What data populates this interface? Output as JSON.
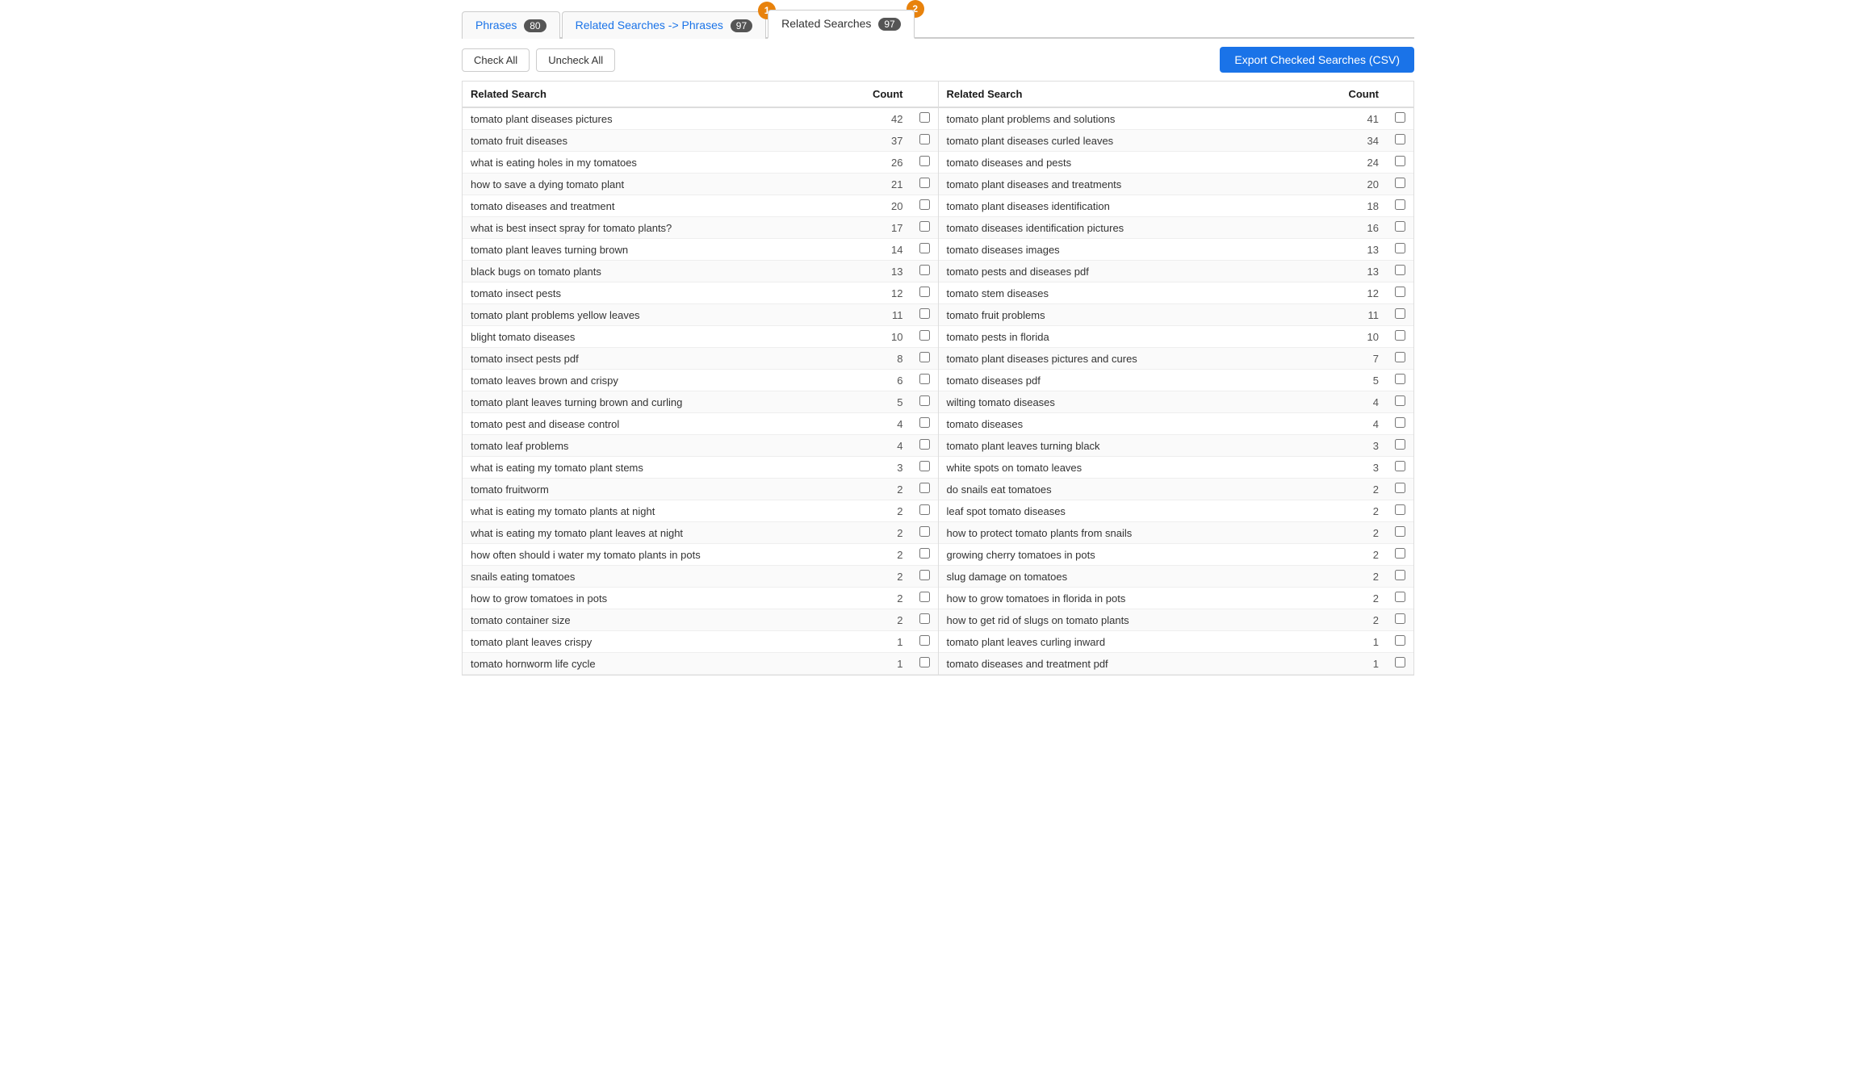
{
  "tabs": [
    {
      "id": "phrases",
      "label": "Phrases",
      "badge": "80",
      "active": false,
      "step": null
    },
    {
      "id": "related-to-phrases",
      "label": "Related Searches -> Phrases",
      "badge": "97",
      "active": false,
      "step": "1"
    },
    {
      "id": "related-searches",
      "label": "Related Searches",
      "badge": "97",
      "active": true,
      "step": "2"
    }
  ],
  "toolbar": {
    "check_all": "Check All",
    "uncheck_all": "Uncheck All",
    "export_button": "Export Checked Searches (CSV)"
  },
  "left_table": {
    "headers": [
      {
        "id": "related-search",
        "label": "Related Search"
      },
      {
        "id": "count",
        "label": "Count"
      },
      {
        "id": "check",
        "label": ""
      }
    ],
    "rows": [
      {
        "search": "tomato plant diseases pictures",
        "count": 42
      },
      {
        "search": "tomato fruit diseases",
        "count": 37
      },
      {
        "search": "what is eating holes in my tomatoes",
        "count": 26
      },
      {
        "search": "how to save a dying tomato plant",
        "count": 21
      },
      {
        "search": "tomato diseases and treatment",
        "count": 20
      },
      {
        "search": "what is best insect spray for tomato plants?",
        "count": 17
      },
      {
        "search": "tomato plant leaves turning brown",
        "count": 14
      },
      {
        "search": "black bugs on tomato plants",
        "count": 13
      },
      {
        "search": "tomato insect pests",
        "count": 12
      },
      {
        "search": "tomato plant problems yellow leaves",
        "count": 11
      },
      {
        "search": "blight tomato diseases",
        "count": 10
      },
      {
        "search": "tomato insect pests pdf",
        "count": 8
      },
      {
        "search": "tomato leaves brown and crispy",
        "count": 6
      },
      {
        "search": "tomato plant leaves turning brown and curling",
        "count": 5
      },
      {
        "search": "tomato pest and disease control",
        "count": 4
      },
      {
        "search": "tomato leaf problems",
        "count": 4
      },
      {
        "search": "what is eating my tomato plant stems",
        "count": 3
      },
      {
        "search": "tomato fruitworm",
        "count": 2
      },
      {
        "search": "what is eating my tomato plants at night",
        "count": 2
      },
      {
        "search": "what is eating my tomato plant leaves at night",
        "count": 2
      },
      {
        "search": "how often should i water my tomato plants in pots",
        "count": 2
      },
      {
        "search": "snails eating tomatoes",
        "count": 2
      },
      {
        "search": "how to grow tomatoes in pots",
        "count": 2
      },
      {
        "search": "tomato container size",
        "count": 2
      },
      {
        "search": "tomato plant leaves crispy",
        "count": 1
      },
      {
        "search": "tomato hornworm life cycle",
        "count": 1
      }
    ]
  },
  "right_table": {
    "headers": [
      {
        "id": "related-search-r",
        "label": "Related Search"
      },
      {
        "id": "count-r",
        "label": "Count"
      },
      {
        "id": "check-r",
        "label": ""
      }
    ],
    "rows": [
      {
        "search": "tomato plant problems and solutions",
        "count": 41
      },
      {
        "search": "tomato plant diseases curled leaves",
        "count": 34
      },
      {
        "search": "tomato diseases and pests",
        "count": 24
      },
      {
        "search": "tomato plant diseases and treatments",
        "count": 20
      },
      {
        "search": "tomato plant diseases identification",
        "count": 18
      },
      {
        "search": "tomato diseases identification pictures",
        "count": 16
      },
      {
        "search": "tomato diseases images",
        "count": 13
      },
      {
        "search": "tomato pests and diseases pdf",
        "count": 13
      },
      {
        "search": "tomato stem diseases",
        "count": 12
      },
      {
        "search": "tomato fruit problems",
        "count": 11
      },
      {
        "search": "tomato pests in florida",
        "count": 10
      },
      {
        "search": "tomato plant diseases pictures and cures",
        "count": 7
      },
      {
        "search": "tomato diseases pdf",
        "count": 5
      },
      {
        "search": "wilting tomato diseases",
        "count": 4
      },
      {
        "search": "tomato diseases",
        "count": 4
      },
      {
        "search": "tomato plant leaves turning black",
        "count": 3
      },
      {
        "search": "white spots on tomato leaves",
        "count": 3
      },
      {
        "search": "do snails eat tomatoes",
        "count": 2
      },
      {
        "search": "leaf spot tomato diseases",
        "count": 2
      },
      {
        "search": "how to protect tomato plants from snails",
        "count": 2
      },
      {
        "search": "growing cherry tomatoes in pots",
        "count": 2
      },
      {
        "search": "slug damage on tomatoes",
        "count": 2
      },
      {
        "search": "how to grow tomatoes in florida in pots",
        "count": 2
      },
      {
        "search": "how to get rid of slugs on tomato plants",
        "count": 2
      },
      {
        "search": "tomato plant leaves curling inward",
        "count": 1
      },
      {
        "search": "tomato diseases and treatment pdf",
        "count": 1
      }
    ]
  }
}
